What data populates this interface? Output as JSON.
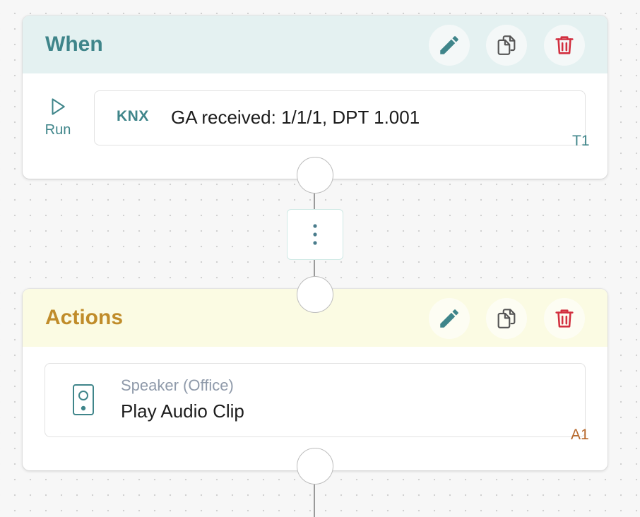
{
  "trigger_section": {
    "title": "When",
    "run_label": "Run",
    "trigger": {
      "badge": "KNX",
      "text": "GA received: 1/1/1, DPT 1.001",
      "id": "T1"
    }
  },
  "actions_section": {
    "title": "Actions",
    "action": {
      "device": "Speaker (Office)",
      "text": "Play Audio Clip",
      "id": "A1"
    }
  },
  "icons": {
    "edit": "pencil-icon",
    "copy": "copy-icon",
    "delete": "trash-icon",
    "run": "play-icon",
    "more": "vertical-ellipsis-icon",
    "speaker": "speaker-icon"
  },
  "colors": {
    "teal": "#3f858a",
    "gold": "#c08c2a",
    "delete_red": "#d22f3f",
    "action_id": "#b7682b"
  }
}
